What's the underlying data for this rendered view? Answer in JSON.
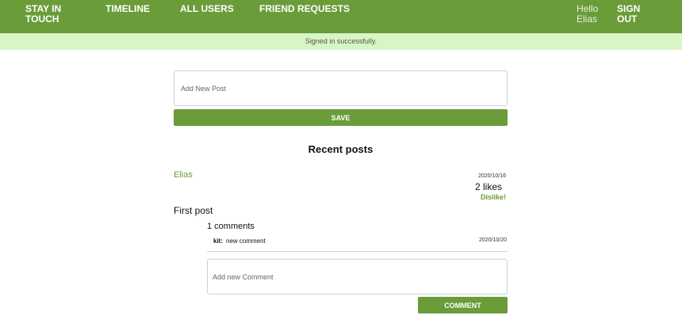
{
  "nav": {
    "brand": "STAY IN TOUCH",
    "links": [
      "TIMELINE",
      "ALL USERS",
      "FRIEND REQUESTS"
    ],
    "greeting": "Hello Elias",
    "signout": "SIGN OUT"
  },
  "flash": "Signed in successfully.",
  "new_post": {
    "placeholder": "Add New Post",
    "save_label": "SAVE"
  },
  "section_title": "Recent posts",
  "posts": [
    {
      "author": "Elias",
      "date": "2020/10/16",
      "likes": "2 likes",
      "dislike_label": "Dislike!",
      "content": "First post",
      "comments_count": "1 comments",
      "comments": [
        {
          "author": "kit:",
          "text": "new comment",
          "date": "2020/10/20"
        }
      ],
      "comment_placeholder": "Add new Comment",
      "comment_button": "COMMENT"
    }
  ],
  "colors": {
    "primary": "#6a9c39",
    "flash_bg": "#d8f5c4"
  }
}
